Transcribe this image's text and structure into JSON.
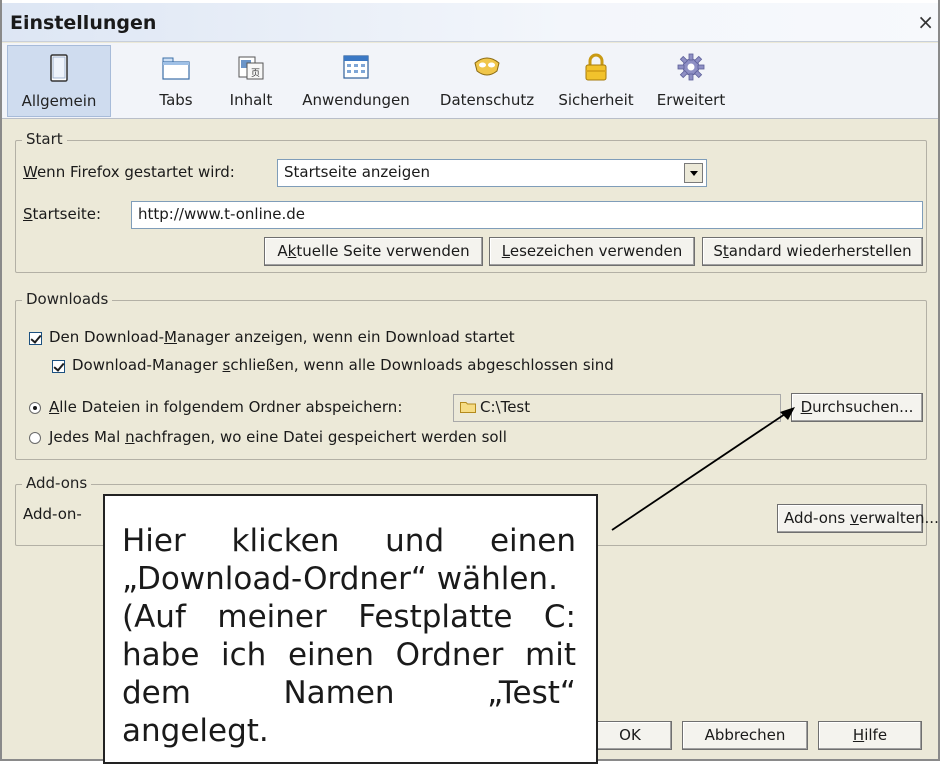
{
  "window": {
    "title": "Einstellungen",
    "close": "×"
  },
  "toolbar": {
    "items": [
      {
        "label": "Allgemein",
        "icon": "window-icon",
        "selected": true
      },
      {
        "label": "Tabs",
        "icon": "tabs-icon",
        "selected": false
      },
      {
        "label": "Inhalt",
        "icon": "content-icon",
        "selected": false
      },
      {
        "label": "Anwendungen",
        "icon": "applications-icon",
        "selected": false
      },
      {
        "label": "Datenschutz",
        "icon": "privacy-mask-icon",
        "selected": false
      },
      {
        "label": "Sicherheit",
        "icon": "padlock-icon",
        "selected": false
      },
      {
        "label": "Erweitert",
        "icon": "gear-icon",
        "selected": false
      }
    ]
  },
  "start": {
    "legend": "Start",
    "startup_label_prefix": "W",
    "startup_label_rest": "enn Firefox gestartet wird:",
    "startup_value": "Startseite anzeigen",
    "homepage_label_prefix": "S",
    "homepage_label_rest": "tartseite:",
    "homepage_value": "http://www.t-online.de",
    "btn_current_pre": "A",
    "btn_current_u": "k",
    "btn_current_rest": "tuelle Seite verwenden",
    "btn_bookmark_u": "L",
    "btn_bookmark_rest": "esezeichen verwenden",
    "btn_default_pre": "S",
    "btn_default_u": "t",
    "btn_default_rest": "andard wiederherstellen"
  },
  "downloads": {
    "legend": "Downloads",
    "show_dm_pre": "Den Download-",
    "show_dm_u": "M",
    "show_dm_rest": "anager anzeigen, wenn ein Download startet",
    "show_dm_checked": true,
    "close_dm_pre": "Download-Manager ",
    "close_dm_u": "s",
    "close_dm_rest": "chließen, wenn alle Downloads abgeschlossen sind",
    "close_dm_checked": true,
    "save_all_u": "A",
    "save_all_rest": "lle Dateien in folgendem Ordner abspeichern:",
    "save_all_selected": true,
    "folder_value": "C:\\Test",
    "browse_u": "D",
    "browse_rest": "urchsuchen...",
    "ask_pre": "Jedes Mal ",
    "ask_u": "n",
    "ask_rest": "achfragen, wo eine Datei gespeichert werden soll",
    "ask_selected": false
  },
  "addons": {
    "legend": "Add-ons",
    "text_visible": "Add-on-",
    "manage_pre": "Add-ons ",
    "manage_u": "v",
    "manage_rest": "erwalten..."
  },
  "footer": {
    "ok": "OK",
    "cancel": "Abbrechen",
    "help_u": "H",
    "help_rest": "ilfe"
  },
  "callout": {
    "lines": [
      "Hier klicken und einen",
      "„Download-Ordner“ wählen.",
      "(Auf meiner Festplatte C:",
      "habe ich einen Ordner mit",
      "dem Namen „Test“",
      "angelegt."
    ]
  },
  "colors": {
    "dialog_bg": "#ece9d8",
    "selected_tab": "#cfdcef",
    "arrow": "#000000"
  }
}
